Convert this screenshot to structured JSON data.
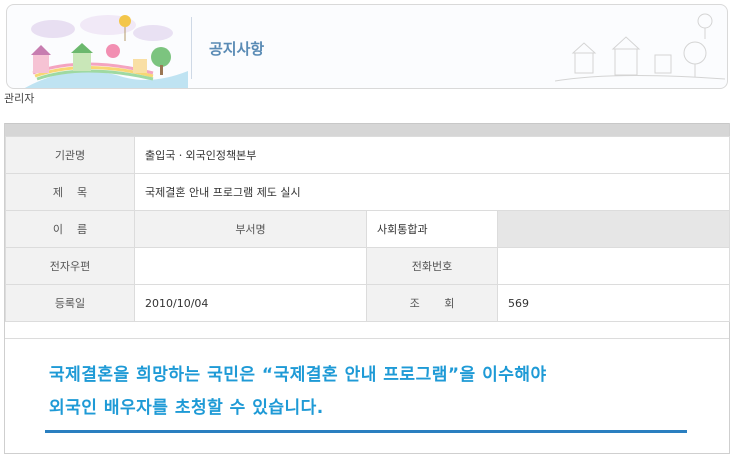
{
  "banner": {
    "title": "공지사항"
  },
  "author": "관리자",
  "info": {
    "agency_label": "기관명",
    "agency_value": "출입국ㆍ외국인정책본부",
    "subject_label": "제    목",
    "subject_value": "국제결혼 안내 프로그램 제도 실시",
    "name_label": "이    름",
    "dept_label": "부서명",
    "dept_value": "사회통합과",
    "email_label": "전자우편",
    "email_value": "",
    "phone_label": "전화번호",
    "phone_value": "",
    "date_label": "등록일",
    "date_value": "2010/10/04",
    "views_label": "조       회",
    "views_value": "569"
  },
  "content": {
    "line1": "국제결혼을 희망하는 국민은 “국제결혼 안내 프로그램”을 이수해야",
    "line2": "외국인 배우자를 초청할 수 있습니다."
  },
  "colors": {
    "accent_blue": "#1e9ad6",
    "title_blue": "#5a8bb5",
    "rule_blue": "#2a7fc0"
  }
}
